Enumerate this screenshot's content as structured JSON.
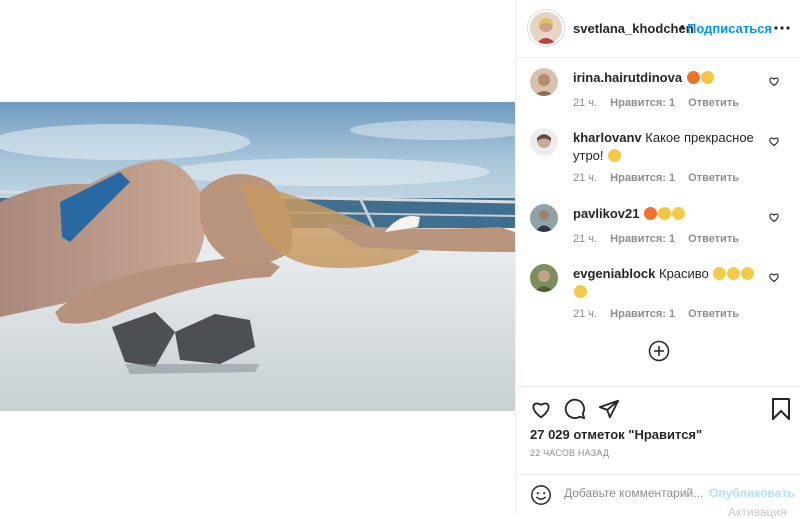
{
  "post": {
    "author": "svetlana_khodchen",
    "dot": "•",
    "follow_label": "Подписаться",
    "image_alt": "photo"
  },
  "comments": [
    {
      "user": "irina.hairutdinova",
      "text": "",
      "emojis": [
        "fire",
        "raised-hands"
      ],
      "time": "21 ч.",
      "likes": "Нравится: 1",
      "reply": "Ответить"
    },
    {
      "user": "kharlovanv",
      "text": "Какое прекрасное утро!",
      "emojis": [
        "heart-eyes"
      ],
      "time": "21 ч.",
      "likes": "Нравится: 1",
      "reply": "Ответить"
    },
    {
      "user": "pavlikov21",
      "text": "",
      "emojis": [
        "fire",
        "clap",
        "heart-eyes"
      ],
      "time": "21 ч.",
      "likes": "Нравится: 1",
      "reply": "Ответить"
    },
    {
      "user": "evgeniablock",
      "text": "Красиво",
      "emojis": [
        "kiss",
        "kiss",
        "kiss",
        "kiss"
      ],
      "time": "21 ч.",
      "likes": "Нравится: 1",
      "reply": "Ответить"
    }
  ],
  "likes_count": "27 029 отметок \"Нравится\"",
  "posted_ago": "22 ЧАСОВ НАЗАД",
  "add_comment": {
    "placeholder": "Добавьте комментарий...",
    "publish_label": "Опубликовать"
  },
  "watermark": "Активация",
  "colors": {
    "link": "#0095f6",
    "publish_disabled": "#b2dffc",
    "meta": "#8e8e8e",
    "text": "#262626",
    "border": "#efefef"
  }
}
